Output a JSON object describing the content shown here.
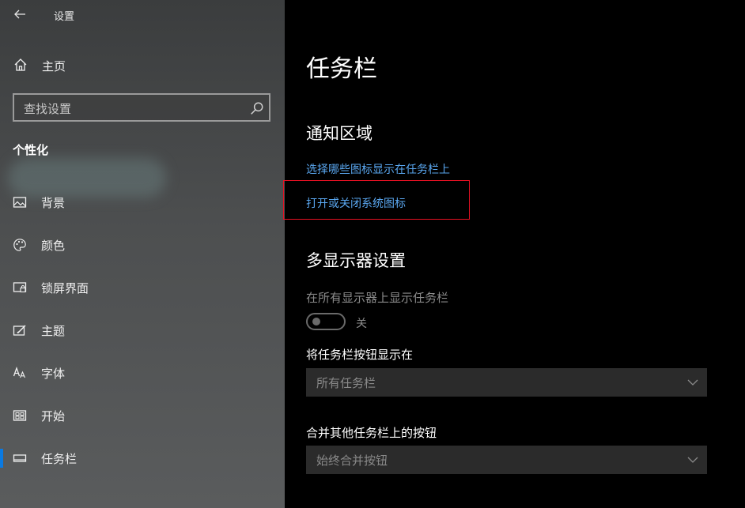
{
  "window": {
    "title": "设置"
  },
  "sidebar": {
    "home_label": "主页",
    "search_placeholder": "查找设置",
    "section": "个性化",
    "items": [
      {
        "label": "背景",
        "icon": "picture-icon"
      },
      {
        "label": "颜色",
        "icon": "palette-icon"
      },
      {
        "label": "锁屏界面",
        "icon": "lock-screen-icon"
      },
      {
        "label": "主题",
        "icon": "theme-icon"
      },
      {
        "label": "字体",
        "icon": "font-icon"
      },
      {
        "label": "开始",
        "icon": "start-icon"
      },
      {
        "label": "任务栏",
        "icon": "taskbar-icon",
        "active": true
      }
    ]
  },
  "main": {
    "title": "任务栏",
    "notification_area": {
      "heading": "通知区域",
      "link1": "选择哪些图标显示在任务栏上",
      "link2": "打开或关闭系统图标"
    },
    "multi_display": {
      "heading": "多显示器设置",
      "show_on_all_label": "在所有显示器上显示任务栏",
      "toggle_state": "关",
      "show_buttons_label": "将任务栏按钮显示在",
      "show_buttons_value": "所有任务栏",
      "combine_label": "合并其他任务栏上的按钮",
      "combine_value": "始终合并按钮"
    }
  },
  "colors": {
    "accent": "#0a7ae2",
    "link": "#5aa7f0",
    "highlight_box": "#e81123"
  }
}
